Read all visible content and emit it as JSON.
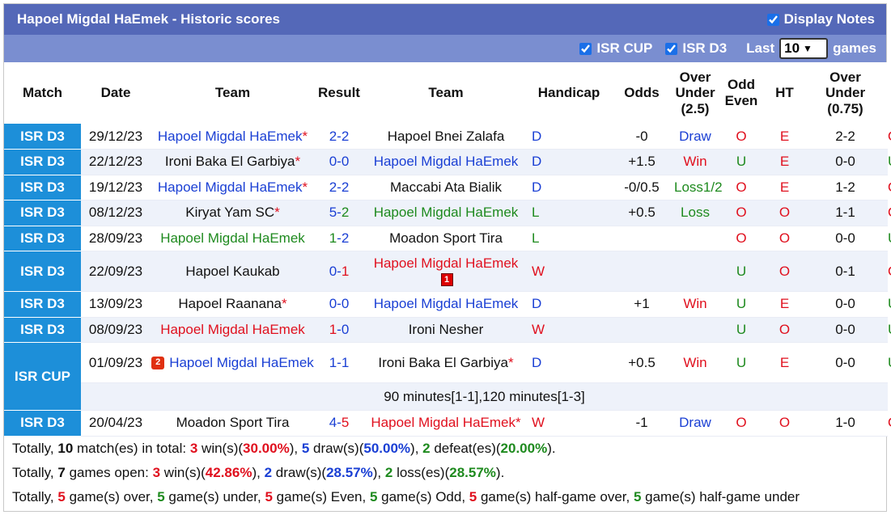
{
  "header": {
    "title": "Hapoel Migdal HaEmek - Historic scores",
    "display_notes_label": "Display Notes"
  },
  "filters": {
    "cup_label": "ISR CUP",
    "d3_label": "ISR D3",
    "last_label": "Last",
    "last_value": "10",
    "games_label": "games"
  },
  "columns": {
    "match": "Match",
    "date": "Date",
    "team1": "Team",
    "result": "Result",
    "team2": "Team",
    "handicap": "Handicap",
    "odds": "Odds",
    "ou25_l1": "Over",
    "ou25_l2": "Under",
    "ou25_l3": "(2.5)",
    "oe_l1": "Odd",
    "oe_l2": "Even",
    "ht": "HT",
    "ou075_l1": "Over",
    "ou075_l2": "Under",
    "ou075_l3": "(0.75)"
  },
  "rows": [
    {
      "league": "ISR D3",
      "date": "29/12/23",
      "home": "Hapoel Migdal HaEmek",
      "home_star": "*",
      "hs": "2",
      "sep": "-",
      "as": "2",
      "away": "Hapoel Bnei Zalafa",
      "away_star": "",
      "wdl": "D",
      "hcp": "-0",
      "odds": "Draw",
      "ou": "O",
      "oe": "E",
      "ht": "2-2",
      "ou2": "O"
    },
    {
      "league": "ISR D3",
      "date": "22/12/23",
      "home": "Ironi Baka El Garbiya",
      "home_star": "*",
      "hs": "0",
      "sep": "-",
      "as": "0",
      "away": "Hapoel Migdal HaEmek",
      "away_star": "",
      "wdl": "D",
      "hcp": "+1.5",
      "odds": "Win",
      "ou": "U",
      "oe": "E",
      "ht": "0-0",
      "ou2": "U"
    },
    {
      "league": "ISR D3",
      "date": "19/12/23",
      "home": "Hapoel Migdal HaEmek",
      "home_star": "*",
      "hs": "2",
      "sep": "-",
      "as": "2",
      "away": "Maccabi Ata Bialik",
      "away_star": "",
      "wdl": "D",
      "hcp": "-0/0.5",
      "odds": "Loss1/2",
      "ou": "O",
      "oe": "E",
      "ht": "1-2",
      "ou2": "O"
    },
    {
      "league": "ISR D3",
      "date": "08/12/23",
      "home": "Kiryat Yam SC",
      "home_star": "*",
      "hs": "5",
      "sep": "-",
      "as": "2",
      "away": "Hapoel Migdal HaEmek",
      "away_star": "",
      "wdl": "L",
      "hcp": "+0.5",
      "odds": "Loss",
      "ou": "O",
      "oe": "O",
      "ht": "1-1",
      "ou2": "O"
    },
    {
      "league": "ISR D3",
      "date": "28/09/23",
      "home": "Hapoel Migdal HaEmek",
      "home_star": "",
      "hs": "1",
      "sep": "-",
      "as": "2",
      "away": "Moadon Sport Tira",
      "away_star": "",
      "wdl": "L",
      "hcp": "",
      "odds": "",
      "ou": "O",
      "oe": "O",
      "ht": "0-0",
      "ou2": "U"
    },
    {
      "league": "ISR D3",
      "date": "22/09/23",
      "home": "Hapoel Kaukab",
      "home_star": "",
      "hs": "0",
      "sep": "-",
      "as": "1",
      "away": "Hapoel Migdal HaEmek",
      "away_star": "",
      "away_card": "1",
      "wdl": "W",
      "hcp": "",
      "odds": "",
      "ou": "U",
      "oe": "O",
      "ht": "0-1",
      "ou2": "O"
    },
    {
      "league": "ISR D3",
      "date": "13/09/23",
      "home": "Hapoel Raanana",
      "home_star": "*",
      "hs": "0",
      "sep": "-",
      "as": "0",
      "away": "Hapoel Migdal HaEmek",
      "away_star": "",
      "wdl": "D",
      "hcp": "+1",
      "odds": "Win",
      "ou": "U",
      "oe": "E",
      "ht": "0-0",
      "ou2": "U"
    },
    {
      "league": "ISR D3",
      "date": "08/09/23",
      "home": "Hapoel Migdal HaEmek",
      "home_star": "",
      "hs": "1",
      "sep": "-",
      "as": "0",
      "away": "Ironi Nesher",
      "away_star": "",
      "wdl": "W",
      "hcp": "",
      "odds": "",
      "ou": "U",
      "oe": "O",
      "ht": "0-0",
      "ou2": "U"
    },
    {
      "league": "ISR CUP",
      "date": "01/09/23",
      "home": "Hapoel Migdal HaEmek",
      "home_star": "",
      "home_card": "2",
      "hs": "1",
      "sep": "-",
      "as": "1",
      "away": "Ironi Baka El Garbiya",
      "away_star": "*",
      "wdl": "D",
      "hcp": "+0.5",
      "odds": "Win",
      "ou": "U",
      "oe": "E",
      "ht": "0-0",
      "ou2": "U",
      "note": "90 minutes[1-1],120 minutes[1-3]"
    },
    {
      "league": "ISR D3",
      "date": "20/04/23",
      "home": "Moadon Sport Tira",
      "home_star": "",
      "hs": "4",
      "sep": "-",
      "as": "5",
      "away": "Hapoel Migdal HaEmek",
      "away_star": "*",
      "wdl": "W",
      "hcp": "-1",
      "odds": "Draw",
      "ou": "O",
      "oe": "O",
      "ht": "1-0",
      "ou2": "O"
    }
  ],
  "summary": {
    "line1": {
      "a": "Totally, ",
      "n": "10",
      "b": " match(es) in total: ",
      "w": "3",
      "wl": " win(s)(",
      "wp": "30.00%",
      "c": "), ",
      "d": "5",
      "dl": " draw(s)(",
      "dp": "50.00%",
      "e": "), ",
      "l": "2",
      "ll": " defeat(es)(",
      "lp": "20.00%",
      "f": ")."
    },
    "line2": {
      "a": "Totally, ",
      "n": "7",
      "b": " games open: ",
      "w": "3",
      "wl": " win(s)(",
      "wp": "42.86%",
      "c": "), ",
      "d": "2",
      "dl": " draw(s)(",
      "dp": "28.57%",
      "e": "), ",
      "l": "2",
      "ll": " loss(es)(",
      "lp": "28.57%",
      "f": ")."
    },
    "line3": {
      "a": "Totally, ",
      "n1": "5",
      "t1": " game(s) over, ",
      "n2": "5",
      "t2": " game(s) under, ",
      "n3": "5",
      "t3": " game(s) Even, ",
      "n4": "5",
      "t4": " game(s) Odd, ",
      "n5": "5",
      "t5": " game(s) half-game over, ",
      "n6": "5",
      "t6": " game(s) half-game under"
    }
  },
  "colors": {
    "blue": "#1a3fd4",
    "green": "#1e8a1e",
    "red": "#e0101e",
    "league_bg": "#1d8fd9",
    "title_bg": "#5468b8",
    "filter_bg": "#7a8ed0"
  }
}
